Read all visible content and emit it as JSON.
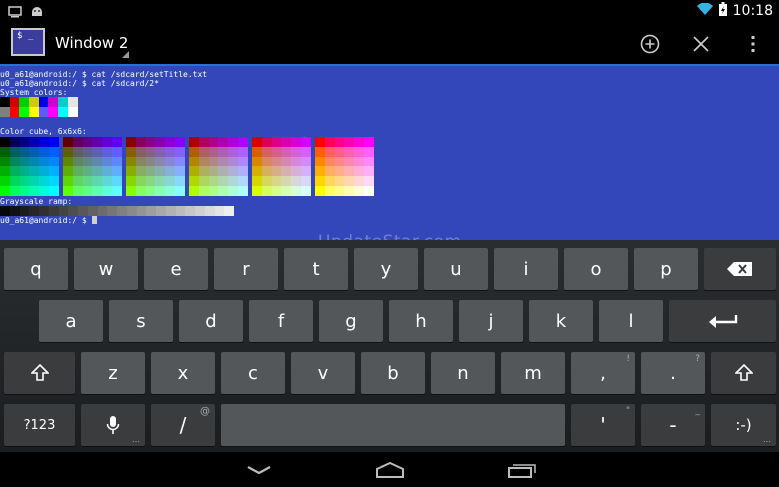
{
  "status_bar": {
    "time": "10:18",
    "icons": [
      "screen-icon",
      "android-icon",
      "wifi-icon",
      "battery-charging-icon"
    ]
  },
  "action_bar": {
    "title": "Window 2",
    "app_icon_text": "$ _",
    "buttons": [
      "new-window-icon",
      "close-window-icon",
      "overflow-menu-icon"
    ]
  },
  "terminal": {
    "lines": [
      "u0_a61@android:/ $ cat /sdcard/setTitle.txt",
      "u0_a61@android:/ $ cat /sdcard/2*",
      "System colors:",
      "Color cube, 6x6x6:",
      "Grayscale ramp:",
      "u0_a61@android:/ $ "
    ],
    "system_colors_top": [
      "#000000",
      "#cd0000",
      "#00cd00",
      "#cdcd00",
      "#0000ee",
      "#cd00cd",
      "#00cdcd",
      "#e5e5e5"
    ],
    "system_colors_bottom": [
      "#7f7f7f",
      "#ff0000",
      "#00ff00",
      "#ffff00",
      "#5c5cff",
      "#ff00ff",
      "#00ffff",
      "#ffffff"
    ],
    "colors": {
      "background": "#3347bb",
      "foreground": "#ffffff"
    }
  },
  "watermark": "UpdateStar.com",
  "keyboard": {
    "row1": [
      "q",
      "w",
      "e",
      "r",
      "t",
      "y",
      "u",
      "i",
      "o",
      "p"
    ],
    "row2": [
      "a",
      "s",
      "d",
      "f",
      "g",
      "h",
      "j",
      "k",
      "l"
    ],
    "row3": [
      "z",
      "x",
      "c",
      "v",
      "b",
      "n",
      "m",
      ",",
      "."
    ],
    "row3_hints": {
      ",": "!",
      ".": "?"
    },
    "symbols_label": "?123",
    "slash": "/",
    "slash_hint": "@",
    "apostrophe": "'",
    "apostrophe_hint": "\"",
    "dash": "-",
    "dash_hint": "_",
    "smiley": ":-)"
  },
  "nav_bar": {
    "buttons": [
      "back-icon",
      "home-icon",
      "recent-apps-icon"
    ]
  }
}
